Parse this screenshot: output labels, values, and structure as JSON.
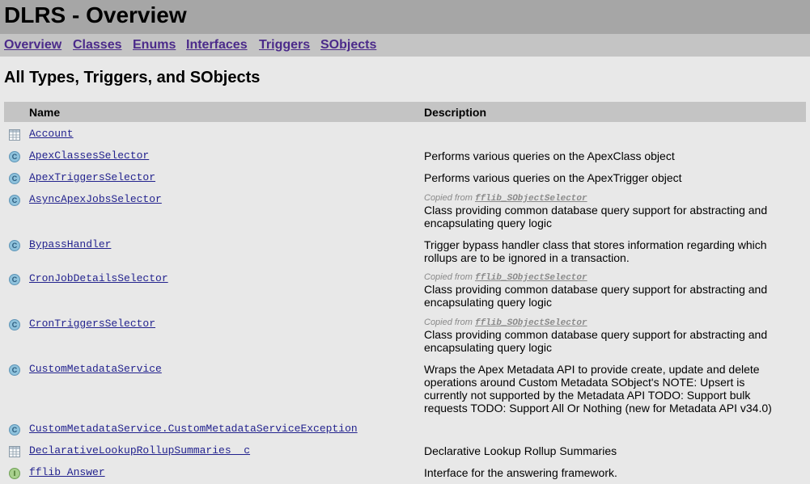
{
  "page": {
    "title": "DLRS - Overview"
  },
  "nav": [
    {
      "label": "Overview"
    },
    {
      "label": "Classes"
    },
    {
      "label": "Enums"
    },
    {
      "label": "Interfaces"
    },
    {
      "label": "Triggers"
    },
    {
      "label": "SObjects"
    }
  ],
  "section_title": "All Types, Triggers, and SObjects",
  "table": {
    "headers": {
      "name": "Name",
      "description": "Description"
    },
    "rows": [
      {
        "icon": "table-icon",
        "name": "Account",
        "copied_from": "",
        "description": ""
      },
      {
        "icon": "class-icon",
        "name": "ApexClassesSelector",
        "copied_from": "",
        "description": "Performs various queries on the ApexClass object"
      },
      {
        "icon": "class-icon",
        "name": "ApexTriggersSelector",
        "copied_from": "",
        "description": "Performs various queries on the ApexTrigger object"
      },
      {
        "icon": "class-icon",
        "name": "AsyncApexJobsSelector",
        "copied_from": "fflib_SObjectSelector",
        "description": "Class providing common database query support for abstracting and encapsulating query logic"
      },
      {
        "icon": "class-icon",
        "name": "BypassHandler",
        "copied_from": "",
        "description": "Trigger bypass handler class that stores information regarding which rollups are to be ignored in a transaction."
      },
      {
        "icon": "class-icon",
        "name": "CronJobDetailsSelector",
        "copied_from": "fflib_SObjectSelector",
        "description": "Class providing common database query support for abstracting and encapsulating query logic"
      },
      {
        "icon": "class-icon",
        "name": "CronTriggersSelector",
        "copied_from": "fflib_SObjectSelector",
        "description": "Class providing common database query support for abstracting and encapsulating query logic"
      },
      {
        "icon": "class-icon",
        "name": "CustomMetadataService",
        "copied_from": "",
        "description": "Wraps the Apex Metadata API to provide create, update and delete operations around Custom Metadata SObject's NOTE: Upsert is currently not supported by the Metadata API TODO: Support bulk requests TODO: Support All Or Nothing (new for Metadata API v34.0)"
      },
      {
        "icon": "class-icon",
        "name": "CustomMetadataService.CustomMetadataServiceException",
        "copied_from": "",
        "description": ""
      },
      {
        "icon": "table-icon",
        "name": "DeclarativeLookupRollupSummaries__c",
        "copied_from": "",
        "description": "Declarative Lookup Rollup Summaries"
      },
      {
        "icon": "interface-icon",
        "name": "fflib_Answer",
        "copied_from": "",
        "description": "Interface for the answering framework."
      }
    ],
    "copied_label": "Copied from"
  },
  "colors": {
    "title_bar": "#a6a6a6",
    "nav_bar": "#c4c4c4",
    "background": "#e8e8e8",
    "link": "#4b2a8a"
  }
}
